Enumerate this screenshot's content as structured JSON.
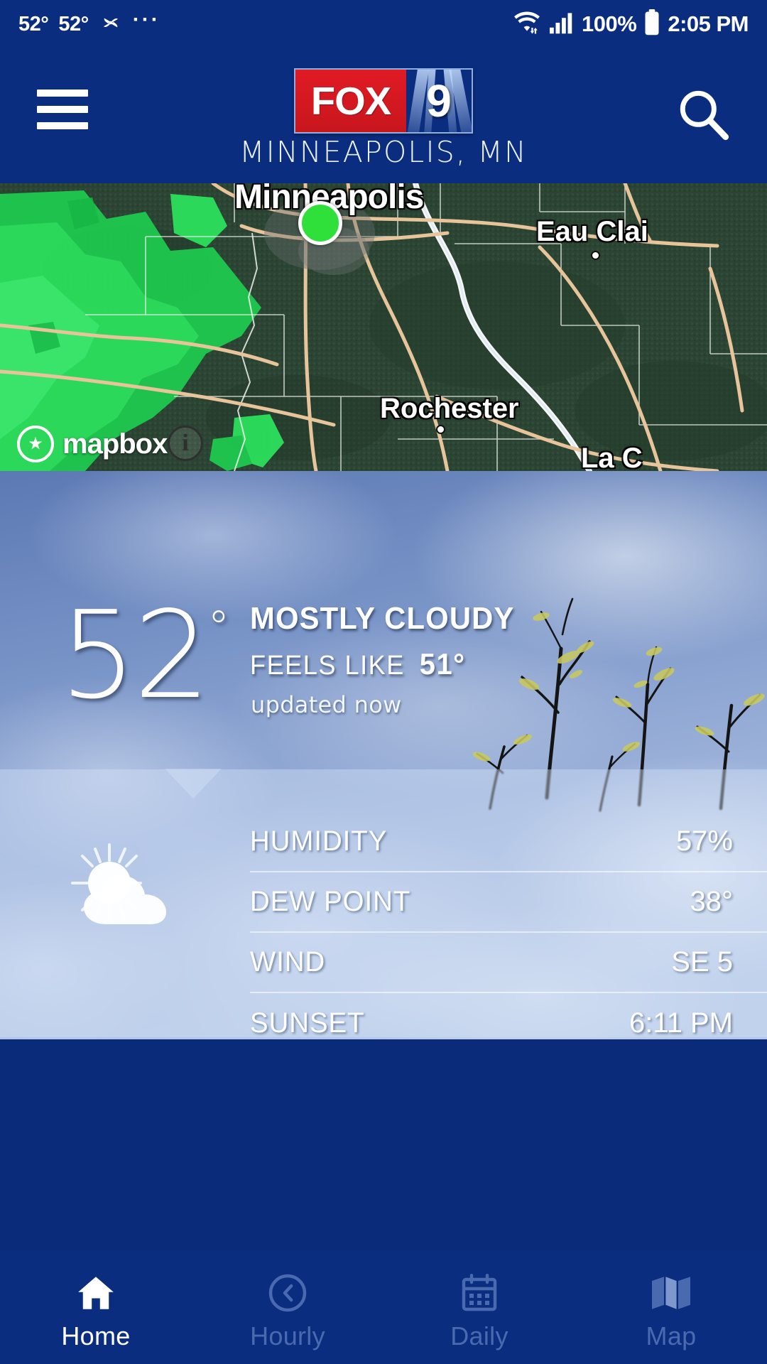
{
  "status_bar": {
    "temp_1": "52°",
    "temp_2": "52°",
    "pinwheel_icon": "pinwheel-icon",
    "overflow_icon": "ellipsis-icon",
    "wifi_icon": "wifi-icon",
    "signal_icon": "cell-signal-icon",
    "battery_percent": "100%",
    "battery_icon": "battery-full-icon",
    "clock": "2:05 PM"
  },
  "header": {
    "menu_icon": "hamburger-menu-icon",
    "search_icon": "search-icon",
    "logo_fox": "FOX",
    "logo_nine": "9",
    "location": "MINNEAPOLIS, MN"
  },
  "map": {
    "attribution": "mapbox",
    "info_icon": "info-icon",
    "marker_icon": "current-location-marker",
    "labels": [
      {
        "name": "Minneapolis"
      },
      {
        "name": "Eau Clai"
      },
      {
        "name": "Rochester"
      },
      {
        "name": "La C"
      }
    ]
  },
  "current": {
    "temperature": "52",
    "degree": "°",
    "condition": "MOSTLY CLOUDY",
    "feels_like_label": "FEELS LIKE",
    "feels_like_value": "51°",
    "updated": "updated now"
  },
  "details": {
    "condition_icon": "sun-behind-cloud-icon",
    "rows": [
      {
        "label": "HUMIDITY",
        "value": "57%"
      },
      {
        "label": "DEW POINT",
        "value": "38°"
      },
      {
        "label": "WIND",
        "value": "SE 5"
      },
      {
        "label": "SUNSET",
        "value": "6:11 PM"
      }
    ]
  },
  "bottom_nav": {
    "items": [
      {
        "label": "Home",
        "icon": "home-icon",
        "active": true
      },
      {
        "label": "Hourly",
        "icon": "clock-icon",
        "active": false
      },
      {
        "label": "Daily",
        "icon": "calendar-icon",
        "active": false
      },
      {
        "label": "Map",
        "icon": "map-icon",
        "active": false
      }
    ]
  },
  "colors": {
    "brand_blue": "#0b2d80",
    "fox_red": "#e01b24",
    "nav_inactive": "#4a6ab0",
    "radar_green": "#2fe03a"
  }
}
